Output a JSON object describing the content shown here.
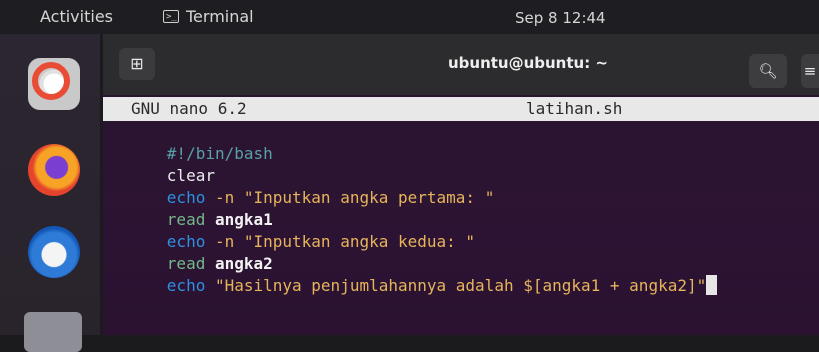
{
  "topbar": {
    "activities": "Activities",
    "app_name": "Terminal",
    "clock": "Sep 8  12:44"
  },
  "dock": {
    "items": [
      "help-icon",
      "firefox-icon",
      "thunderbird-icon",
      "files-icon"
    ]
  },
  "terminal": {
    "title": "ubuntu@ubuntu: ~",
    "newtab_icon": "new-tab-icon",
    "search_icon": "search-icon"
  },
  "nano": {
    "version": "GNU nano 6.2",
    "filename": "latihan.sh"
  },
  "code": {
    "l1": "#!/bin/bash",
    "l2": "clear",
    "l3_kw": "echo",
    "l3_flag": " -n",
    "l3_str": " \"Inputkan angka pertama: \"",
    "l4_kw": "read",
    "l4_var": " angka1",
    "l5_kw": "echo",
    "l5_flag": " -n",
    "l5_str": " \"Inputkan angka kedua: \"",
    "l6_kw": "read",
    "l6_var": " angka2",
    "l7_kw": "echo",
    "l7_str": " \"Hasilnya penjumlahannya adalah $[angka1 + angka2]\""
  },
  "colors": {
    "keyword": "#2f8fe0",
    "string": "#e6b45a",
    "comment": "#5aa0a8",
    "terminal_bg": "#2c1333"
  }
}
